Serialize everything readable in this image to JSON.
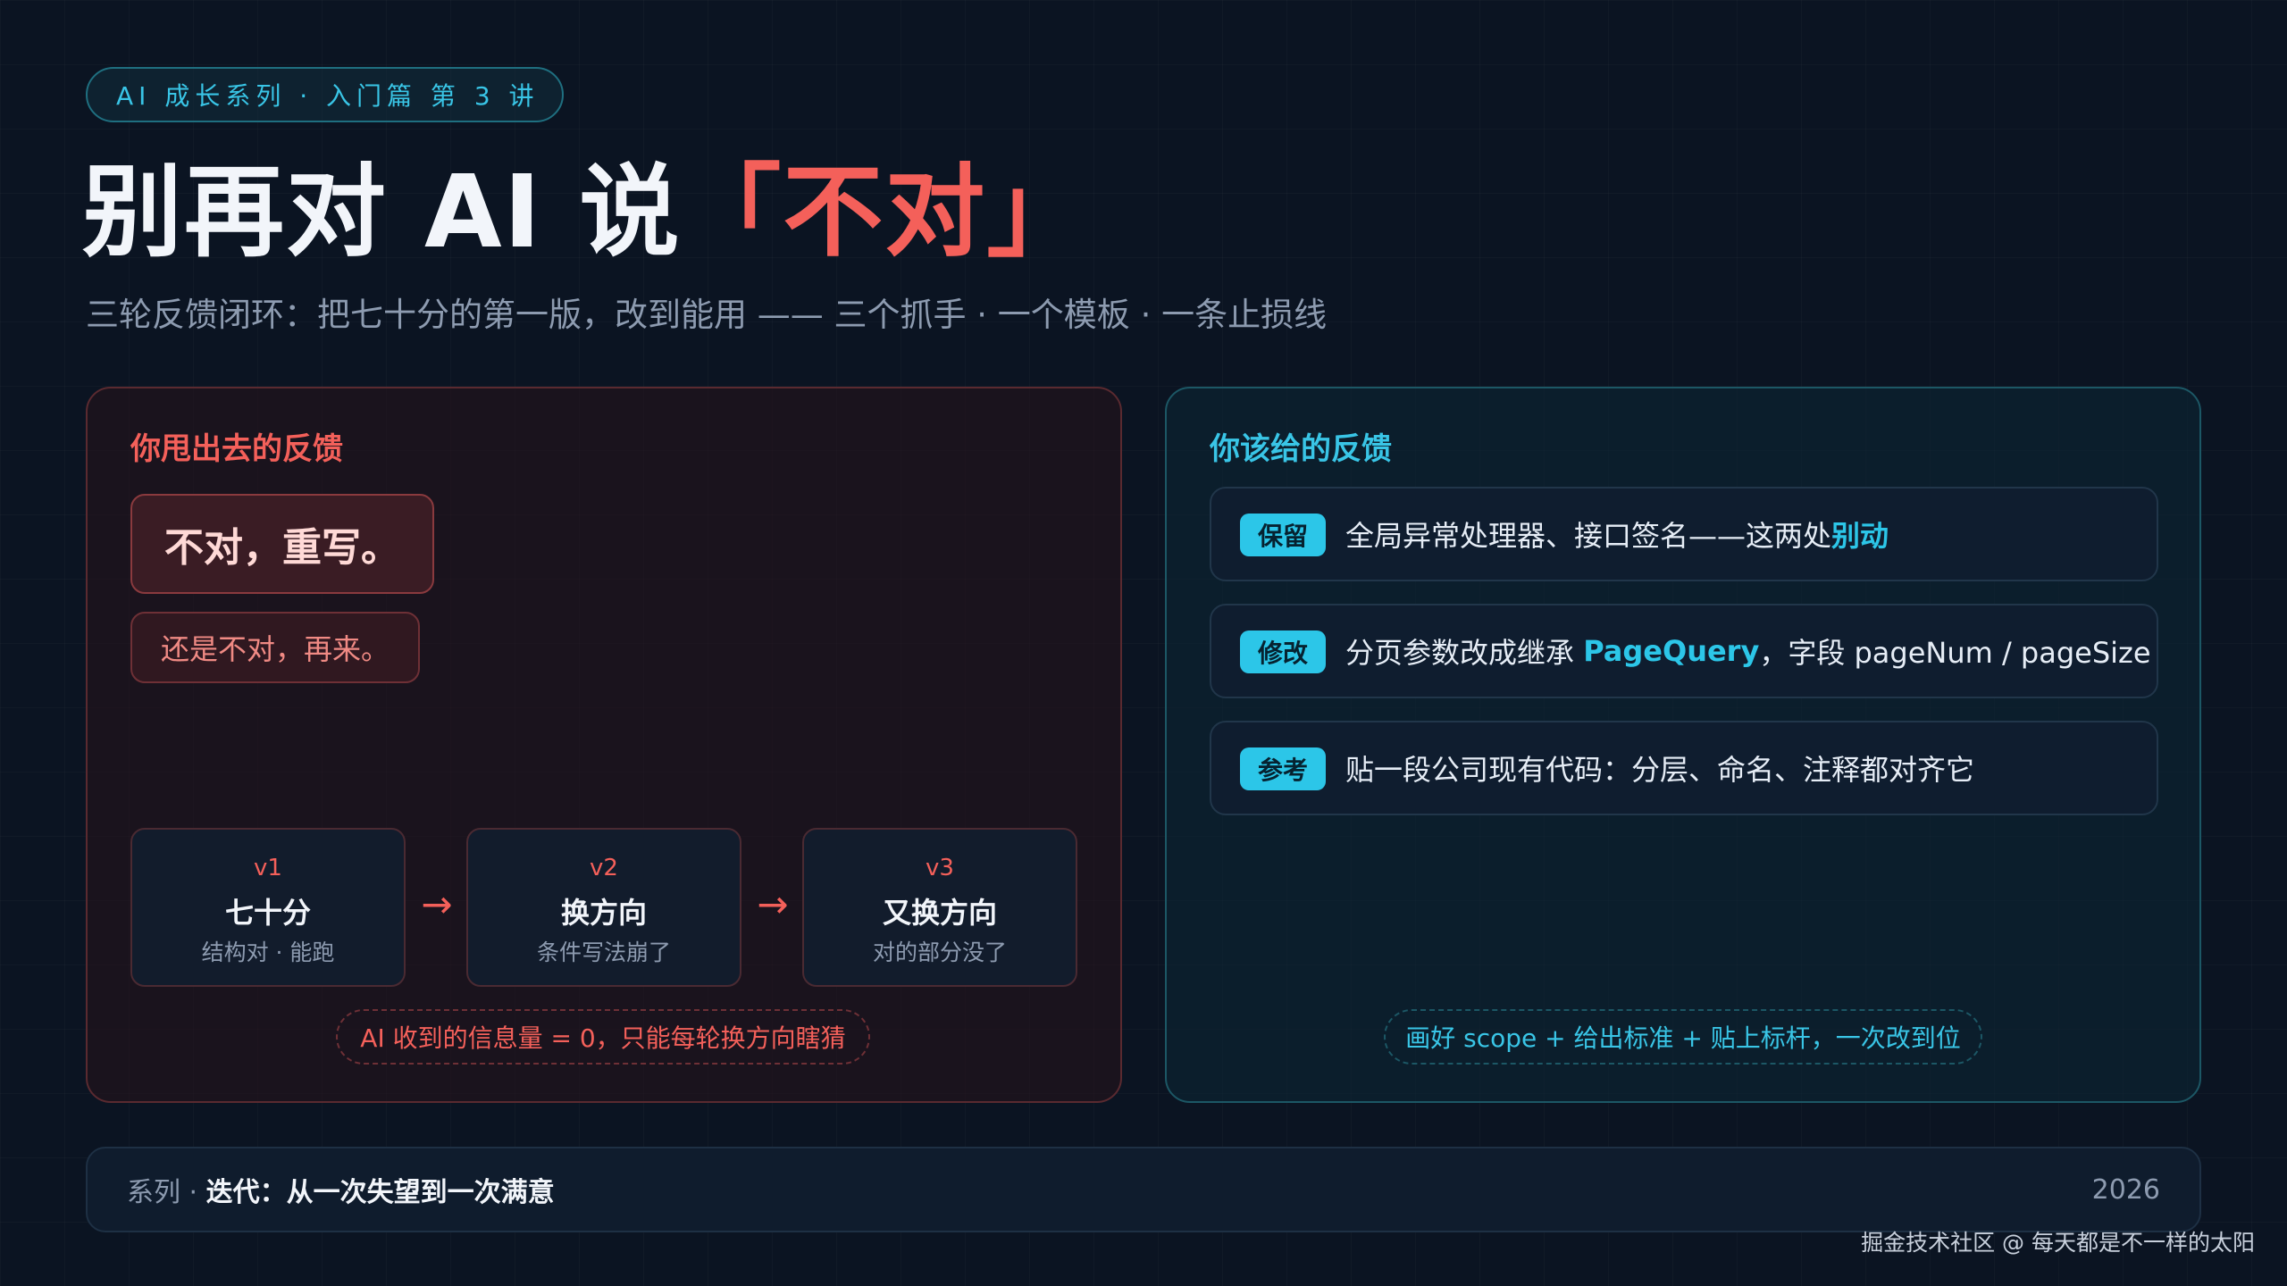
{
  "header": {
    "series_pill": "AI 成长系列 · 入门篇 第 3 讲",
    "title_main": "别再对 AI 说",
    "title_accent": "「不对」",
    "subtitle": "三轮反馈闭环：把七十分的第一版，改到能用 —— 三个抓手 · 一个模板 · 一条止损线"
  },
  "left_panel": {
    "heading": "你甩出去的反馈",
    "bubble_primary": "不对，重写。",
    "bubble_secondary": "还是不对，再来。",
    "versions": [
      {
        "label": "v1",
        "title": "七十分",
        "desc": "结构对 · 能跑"
      },
      {
        "label": "v2",
        "title": "换方向",
        "desc": "条件写法崩了"
      },
      {
        "label": "v3",
        "title": "又换方向",
        "desc": "对的部分没了"
      }
    ],
    "arrow": "→",
    "note": "AI 收到的信息量 = 0，只能每轮换方向瞎猜"
  },
  "right_panel": {
    "heading": "你该给的反馈",
    "rows": [
      {
        "tag": "保留",
        "text": "全局异常处理器、接口签名——这两处",
        "highlight": "别动",
        "suffix": ""
      },
      {
        "tag": "修改",
        "text": "分页参数改成继承 ",
        "highlight": "PageQuery",
        "suffix": "，字段 pageNum / pageSize"
      },
      {
        "tag": "参考",
        "text": "贴一段公司现有代码：分层、命名、注释都对齐它",
        "highlight": "",
        "suffix": ""
      }
    ],
    "note": "画好 scope + 给出标准 + 贴上标杆，一次改到位"
  },
  "footer": {
    "prefix": "系列 · ",
    "series_name": "迭代：从一次失望到一次满意",
    "year": "2026"
  },
  "watermark": "掘金技术社区 @ 每天都是不一样的太阳",
  "colors": {
    "background": "#0b1422",
    "accent_red": "#f4605a",
    "accent_cyan": "#39c5e6",
    "tag_cyan": "#2cc6e8"
  }
}
